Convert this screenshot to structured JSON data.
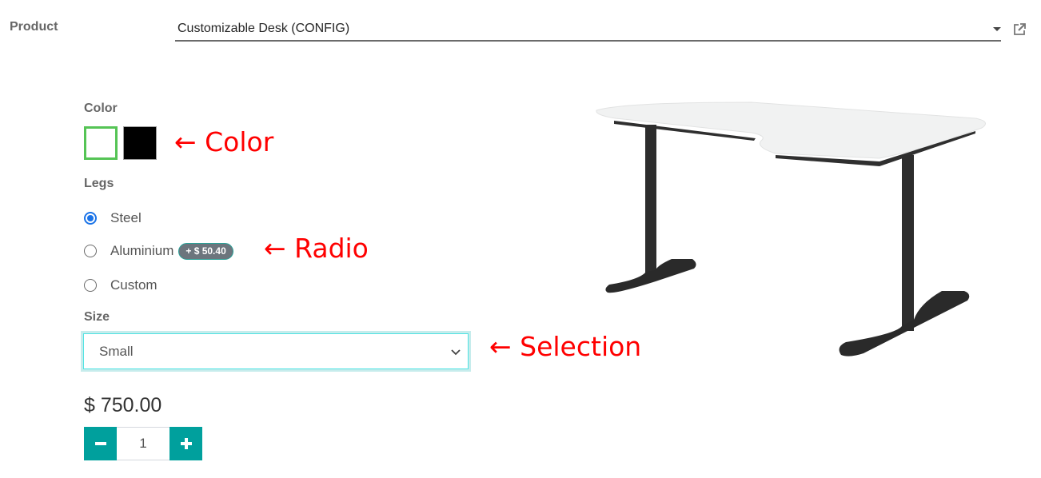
{
  "product": {
    "label": "Product",
    "value": "Customizable Desk (CONFIG)",
    "caret_icon": "caret-down-icon",
    "link_icon": "external-link-icon"
  },
  "attributes": {
    "color": {
      "label": "Color",
      "swatches": [
        {
          "name": "White",
          "hex": "#ffffff",
          "selected": true
        },
        {
          "name": "Black",
          "hex": "#000000",
          "selected": false
        }
      ]
    },
    "legs": {
      "label": "Legs",
      "options": [
        {
          "label": "Steel",
          "checked": true,
          "extra": null
        },
        {
          "label": "Aluminium",
          "checked": false,
          "extra": "+ $ 50.40"
        },
        {
          "label": "Custom",
          "checked": false,
          "extra": null
        }
      ]
    },
    "size": {
      "label": "Size",
      "selected": "Small"
    }
  },
  "price": "$ 750.00",
  "quantity": {
    "value": "1",
    "minus_label": "−",
    "plus_label": "+"
  },
  "annotations": {
    "color": "← Color",
    "radio": "← Radio",
    "selection": "← Selection"
  },
  "colors": {
    "accent": "#00a09d",
    "radio_checked": "#1a73e8",
    "swatch_selected_border": "#55c455",
    "annotation": "#ff0000",
    "badge_bg": "#6c757d"
  },
  "image": {
    "alt": "Corner desk with white top and black T-legs"
  }
}
